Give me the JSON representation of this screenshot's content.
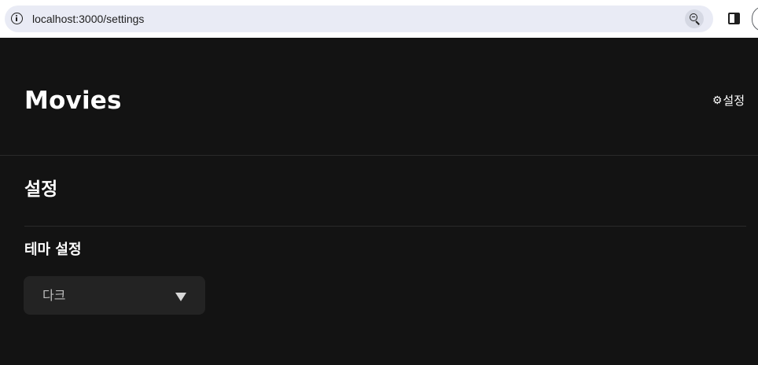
{
  "browser": {
    "url": "localhost:3000/settings",
    "icons": {
      "site_info": "info-icon",
      "zoom": "zoom-icon",
      "side_panel": "side-panel-icon",
      "profile": "profile-icon"
    }
  },
  "header": {
    "title": "Movies",
    "settings_link": {
      "icon": "gear-icon",
      "icon_glyph": "⚙",
      "label": "설정"
    }
  },
  "settings_page": {
    "title": "설정",
    "theme_section": {
      "heading": "테마 설정",
      "selected_value": "다크"
    }
  },
  "colors": {
    "background": "#131313",
    "text": "#ffffff",
    "select_background": "#232323",
    "divider": "#2a2a2a",
    "address_bar": "#e9ebf5"
  }
}
